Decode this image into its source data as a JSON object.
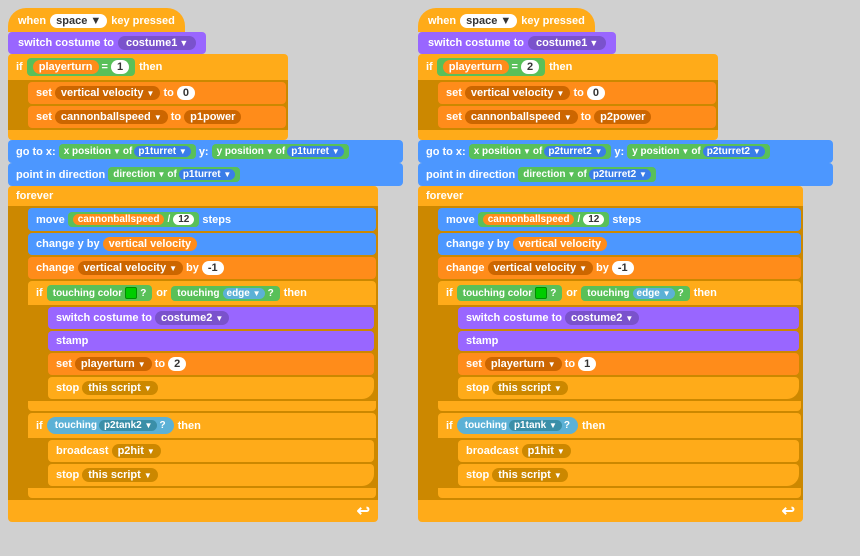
{
  "col1": {
    "hat": "when space ▼ key pressed",
    "block1": "switch costume to costume1 ▼",
    "if1_cond": "playerturn = 1",
    "if1_body": [
      "set vertical velocity ▼ to 0",
      "set cannonballspeed ▼ to p1power"
    ],
    "goto": "go to x:  x position ▼ of p1turret ▼  y:  y position ▼ of p1turret ▼",
    "point": "point in direction  direction ▼ of p1turret ▼",
    "forever_label": "forever",
    "move": "move  cannonballspeed / 12  steps",
    "changey": "change y by  vertical velocity",
    "changev": "change  vertical velocity ▼  by  -1",
    "if2_cond": "touching color □? or touching edge ▼?",
    "if2_body1": "switch costume to costume2 ▼",
    "if2_body2": "stamp",
    "if2_body3": "set playerturn ▼ to 2",
    "if2_body4": "stop this script ▼",
    "if3_cond": "touching p2tank2 ▼?",
    "if3_body1": "broadcast p2hit ▼",
    "if3_body2": "stop this script ▼"
  },
  "col2": {
    "hat": "when space ▼ key pressed",
    "block1": "switch costume to costume1 ▼",
    "if1_cond": "playerturn = 2",
    "if1_body": [
      "set vertical velocity ▼ to 0",
      "set cannonballspeed ▼ to p2power"
    ],
    "goto": "go to x:  x position ▼ of p2turret2 ▼  y:  y position ▼ of p2turret2 ▼",
    "point": "point in direction  direction ▼ of p2turret2 ▼",
    "forever_label": "forever",
    "move": "move  cannonballspeed / 12  steps",
    "changey": "change y by  vertical velocity",
    "changev": "change  vertical velocity ▼  by  -1",
    "if2_cond": "touching color □? or touching edge ▼?",
    "if2_body1": "switch costume to costume2 ▼",
    "if2_body2": "stamp",
    "if2_body3": "set playerturn ▼ to 1",
    "if2_body4": "stop this script ▼",
    "if3_cond": "touching p1tank ▼?",
    "if3_body1": "broadcast p1hit ▼",
    "if3_body2": "stop this script ▼"
  }
}
